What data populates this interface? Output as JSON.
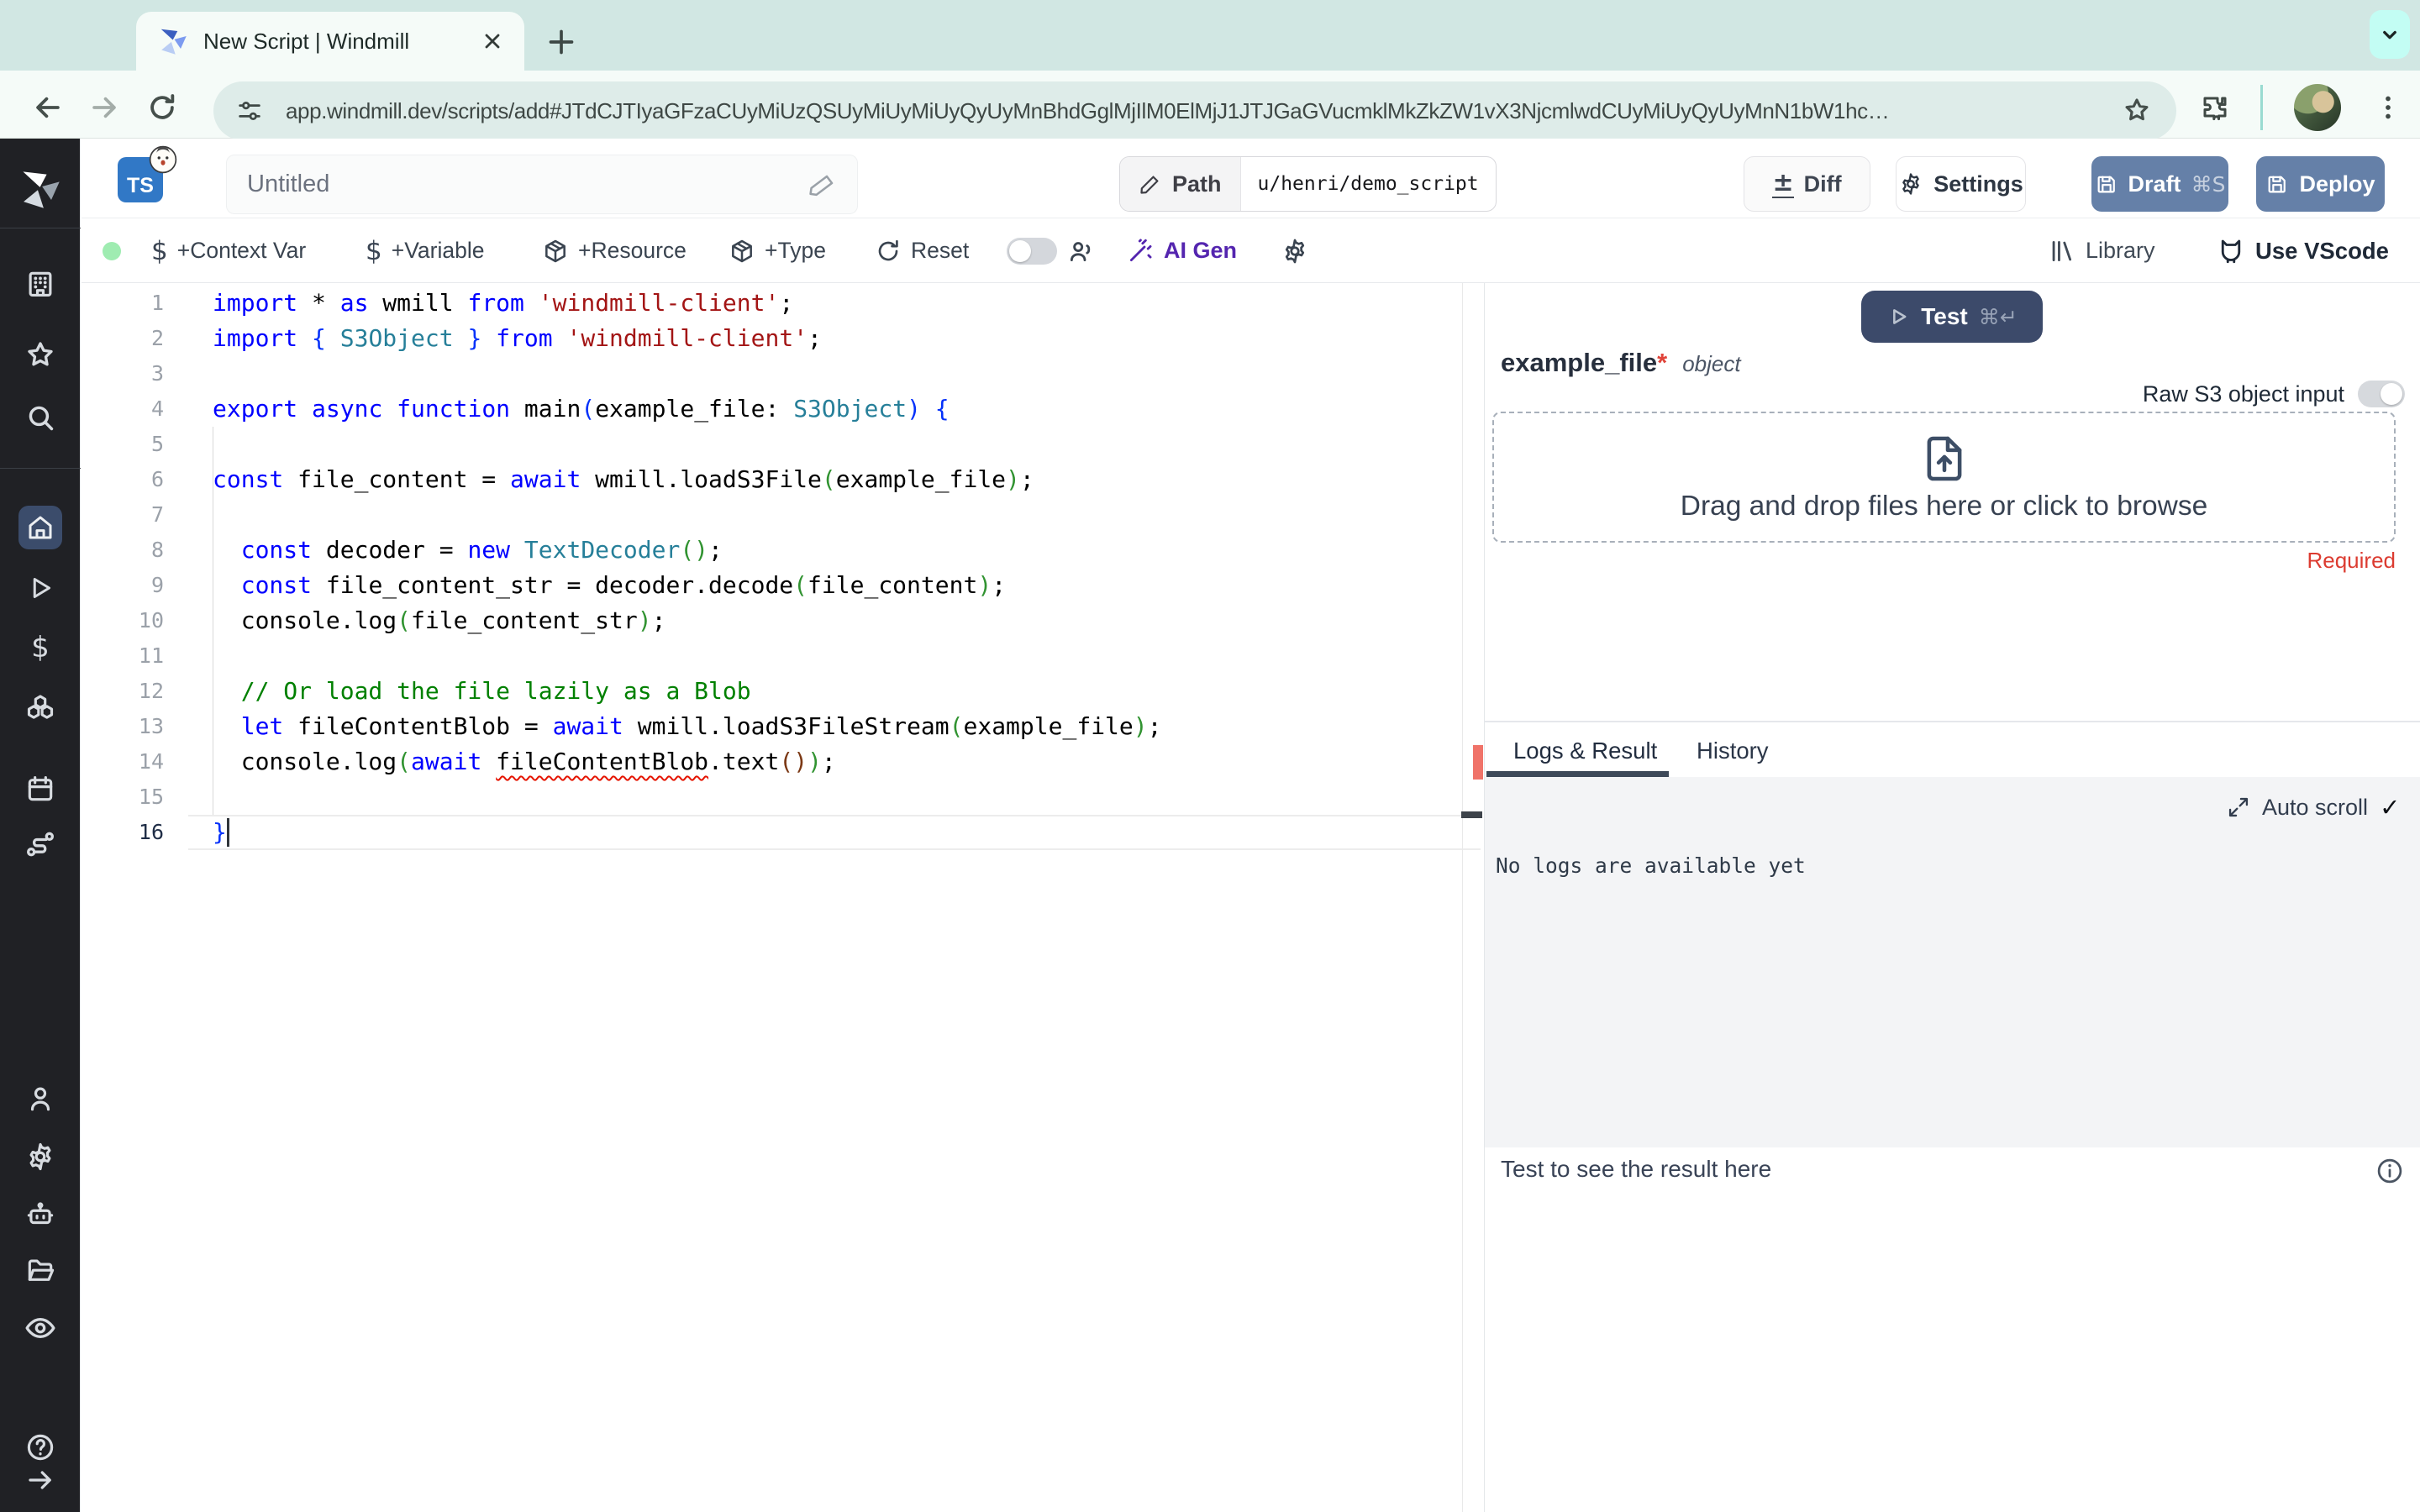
{
  "browser": {
    "tab_title": "New Script | Windmill",
    "url": "app.windmill.dev/scripts/add#JTdCJTIyaGFzaCUyMiUzQSUyMiUyMiUyQyUyMnBhdGglMjIlM0ElMjJ1JTJGaGVucmklMkZkZW1vX3NjcmlwdCUyMiUyQyUyMnN1bW1hc…"
  },
  "header": {
    "language_badge": "TS",
    "script_title": "Untitled",
    "path_label": "Path",
    "path_value": "u/henri/demo_script",
    "diff_label": "Diff",
    "settings_label": "Settings",
    "draft_label": "Draft",
    "draft_shortcut": "⌘S",
    "deploy_label": "Deploy"
  },
  "toolbar": {
    "context_var_label": "+Context Var",
    "variable_label": "+Variable",
    "resource_label": "+Resource",
    "type_label": "+Type",
    "reset_label": "Reset",
    "ai_gen_label": "AI Gen",
    "library_label": "Library",
    "vscode_label": "Use VScode"
  },
  "editor": {
    "language": "typescript",
    "lines": [
      {
        "n": 1,
        "t": [
          [
            "kw",
            "import"
          ],
          [
            "pl",
            " * "
          ],
          [
            "kw",
            "as"
          ],
          [
            "pl",
            " wmill "
          ],
          [
            "kw",
            "from"
          ],
          [
            "pl",
            " "
          ],
          [
            "str",
            "'windmill-client'"
          ],
          [
            "pl",
            ";"
          ]
        ]
      },
      {
        "n": 2,
        "t": [
          [
            "kw",
            "import"
          ],
          [
            "pl",
            " "
          ],
          [
            "b1",
            "{"
          ],
          [
            "pl",
            " "
          ],
          [
            "type",
            "S3Object"
          ],
          [
            "pl",
            " "
          ],
          [
            "b1",
            "}"
          ],
          [
            "pl",
            " "
          ],
          [
            "kw",
            "from"
          ],
          [
            "pl",
            " "
          ],
          [
            "str",
            "'windmill-client'"
          ],
          [
            "pl",
            ";"
          ]
        ]
      },
      {
        "n": 3,
        "t": []
      },
      {
        "n": 4,
        "t": [
          [
            "kw",
            "export"
          ],
          [
            "pl",
            " "
          ],
          [
            "kw",
            "async"
          ],
          [
            "pl",
            " "
          ],
          [
            "kw",
            "function"
          ],
          [
            "pl",
            " main"
          ],
          [
            "b1",
            "("
          ],
          [
            "pl",
            "example_file: "
          ],
          [
            "type",
            "S3Object"
          ],
          [
            "b1",
            ")"
          ],
          [
            "pl",
            " "
          ],
          [
            "b1",
            "{"
          ]
        ]
      },
      {
        "n": 5,
        "t": []
      },
      {
        "n": 6,
        "t": [
          [
            "kw",
            "const"
          ],
          [
            "pl",
            " file_content = "
          ],
          [
            "kw",
            "await"
          ],
          [
            "pl",
            " wmill.loadS3File"
          ],
          [
            "b2",
            "("
          ],
          [
            "pl",
            "example_file"
          ],
          [
            "b2",
            ")"
          ],
          [
            "pl",
            ";"
          ]
        ]
      },
      {
        "n": 7,
        "t": []
      },
      {
        "n": 8,
        "t": [
          [
            "pl",
            "  "
          ],
          [
            "kw",
            "const"
          ],
          [
            "pl",
            " decoder = "
          ],
          [
            "kw",
            "new"
          ],
          [
            "pl",
            " "
          ],
          [
            "type",
            "TextDecoder"
          ],
          [
            "b2",
            "()"
          ],
          [
            "pl",
            ";"
          ]
        ]
      },
      {
        "n": 9,
        "t": [
          [
            "pl",
            "  "
          ],
          [
            "kw",
            "const"
          ],
          [
            "pl",
            " file_content_str = decoder.decode"
          ],
          [
            "b2",
            "("
          ],
          [
            "pl",
            "file_content"
          ],
          [
            "b2",
            ")"
          ],
          [
            "pl",
            ";"
          ]
        ]
      },
      {
        "n": 10,
        "t": [
          [
            "pl",
            "  console.log"
          ],
          [
            "b2",
            "("
          ],
          [
            "pl",
            "file_content_str"
          ],
          [
            "b2",
            ")"
          ],
          [
            "pl",
            ";"
          ]
        ]
      },
      {
        "n": 11,
        "t": []
      },
      {
        "n": 12,
        "t": [
          [
            "cmt",
            "  // Or load the file lazily as a Blob"
          ]
        ]
      },
      {
        "n": 13,
        "t": [
          [
            "pl",
            "  "
          ],
          [
            "kw",
            "let"
          ],
          [
            "pl",
            " fileContentBlob = "
          ],
          [
            "kw",
            "await"
          ],
          [
            "pl",
            " wmill.loadS3FileStream"
          ],
          [
            "b2",
            "("
          ],
          [
            "pl",
            "example_file"
          ],
          [
            "b2",
            ")"
          ],
          [
            "pl",
            ";"
          ]
        ]
      },
      {
        "n": 14,
        "t": [
          [
            "pl",
            "  console.log"
          ],
          [
            "b2",
            "("
          ],
          [
            "kw",
            "await"
          ],
          [
            "pl",
            " "
          ],
          [
            "sq",
            "fileContentBlob"
          ],
          [
            "pl",
            ".text"
          ],
          [
            "b3",
            "()"
          ],
          [
            "b2",
            ")"
          ],
          [
            "pl",
            ";"
          ]
        ]
      },
      {
        "n": 15,
        "t": []
      },
      {
        "n": 16,
        "t": [
          [
            "b1",
            "}"
          ]
        ]
      }
    ]
  },
  "run_panel": {
    "test_label": "Test",
    "test_shortcut": "⌘↵",
    "field_name": "example_file",
    "required_mark": "*",
    "field_type": "object",
    "raw_s3_label": "Raw S3 object input",
    "dropzone_text": "Drag and drop files here or click to browse",
    "required_label": "Required"
  },
  "logs_panel": {
    "tab_logs": "Logs & Result",
    "tab_history": "History",
    "autoscroll_label": "Auto scroll",
    "autoscroll_check": "✓",
    "empty_text": "No logs are available yet"
  },
  "result_panel": {
    "placeholder": "Test to see the result here"
  },
  "sidebar": {
    "icons": [
      "windmill-logo",
      "workspace",
      "favorites",
      "search",
      "home",
      "runs",
      "variables",
      "resources",
      "schedules",
      "flows",
      "user",
      "settings",
      "workers",
      "folders",
      "audit-logs",
      "help",
      "expand"
    ]
  },
  "colors": {
    "accent_blue": "#6580a8",
    "sidebar_bg": "#202125",
    "active_item_bg": "#3b4c6b",
    "test_button": "#3c4a6a",
    "ai_gen": "#5425af",
    "error_red": "#f07369",
    "tabstrip": "#d1e7e3",
    "toolbar_chrome": "#f5fbf8",
    "url_pill": "#deece9"
  }
}
